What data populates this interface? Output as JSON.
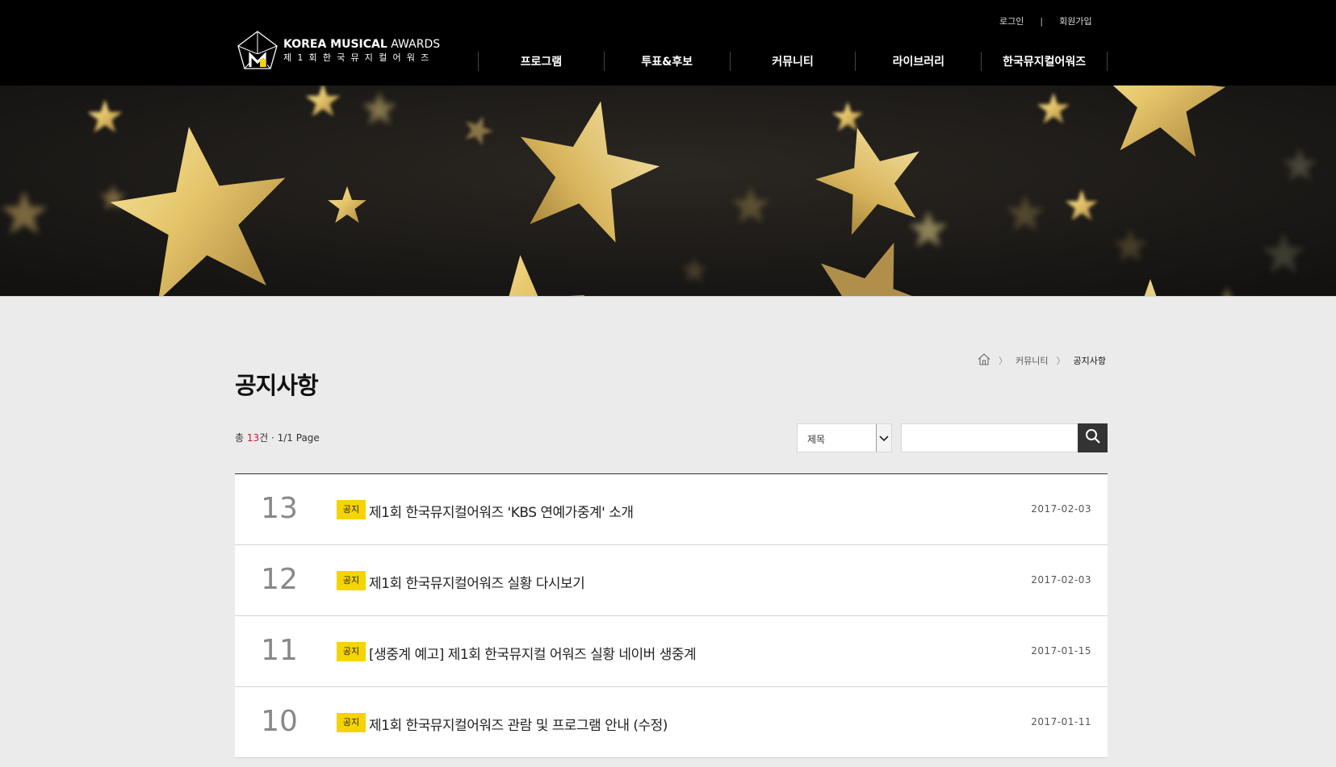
{
  "header": {
    "util": {
      "login": "로그인",
      "separator": "|",
      "join": "회원가입"
    },
    "logo": {
      "en_bold": "KOREA MUSICAL",
      "en_light": "AWARDS",
      "ko": "제1회한국뮤지컬어워즈"
    },
    "nav": [
      {
        "label": "프로그램"
      },
      {
        "label": "투표&후보"
      },
      {
        "label": "커뮤니티"
      },
      {
        "label": "라이브러리"
      },
      {
        "label": "한국뮤지컬어워즈"
      }
    ]
  },
  "breadcrumb": {
    "home_icon": "home-icon",
    "items": [
      "커뮤니티",
      "공지사항"
    ]
  },
  "page": {
    "title": "공지사항"
  },
  "summary": {
    "prefix": "총 ",
    "total": "13",
    "suffix": "건 · 1/1 Page"
  },
  "search": {
    "field_selected": "제목",
    "input_value": "",
    "search_icon": "search-icon"
  },
  "colors": {
    "badge": "#f6d400",
    "count_highlight": "#d7143c",
    "header_bg": "#000000"
  },
  "notices": [
    {
      "no": "13",
      "badge": "공지",
      "subject": "제1회 한국뮤지컬어워즈 'KBS 연예가중계' 소개",
      "date": "2017-02-03"
    },
    {
      "no": "12",
      "badge": "공지",
      "subject": "제1회 한국뮤지컬어워즈 실황 다시보기",
      "date": "2017-02-03"
    },
    {
      "no": "11",
      "badge": "공지",
      "subject": "[생중계 예고] 제1회 한국뮤지컬 어워즈 실황 네이버 생중계",
      "date": "2017-01-15"
    },
    {
      "no": "10",
      "badge": "공지",
      "subject": "제1회 한국뮤지컬어워즈 관람 및 프로그램 안내 (수정)",
      "date": "2017-01-11"
    }
  ]
}
